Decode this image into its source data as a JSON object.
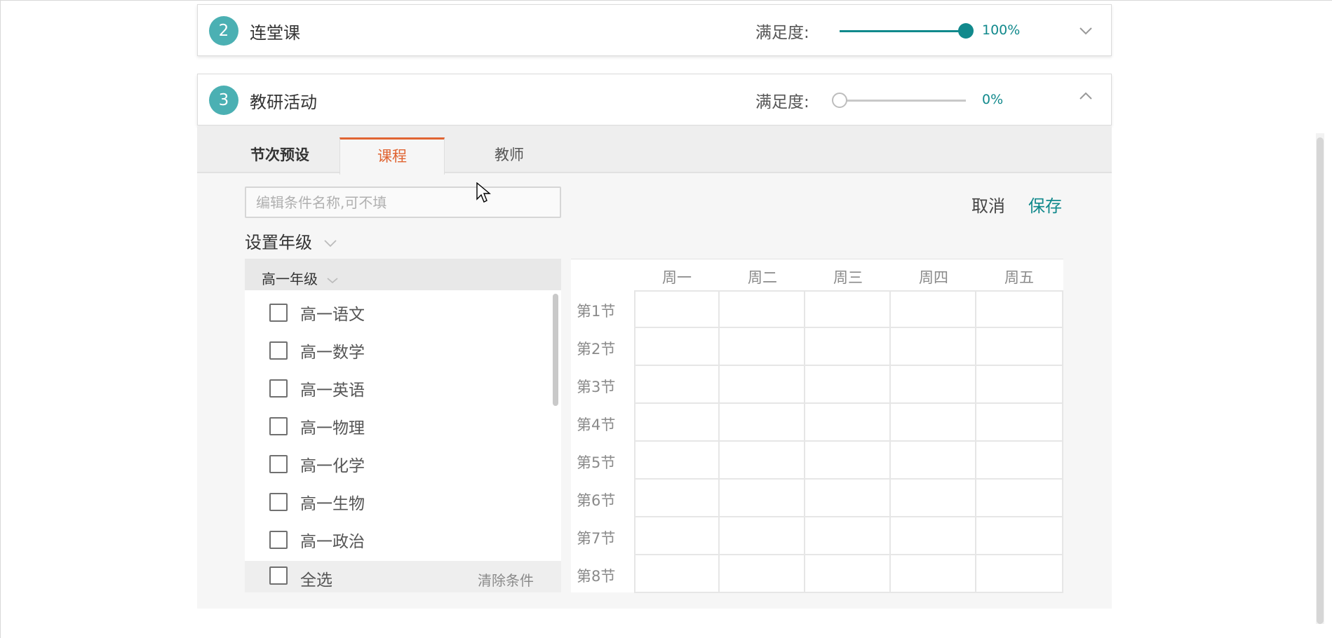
{
  "panels": [
    {
      "number": "2",
      "title": "连堂课",
      "sat_label": "满足度:",
      "sat_value": 100,
      "sat_text": "100%",
      "expanded": false
    },
    {
      "number": "3",
      "title": "教研活动",
      "sat_label": "满足度:",
      "sat_value": 0,
      "sat_text": "0%",
      "expanded": true
    }
  ],
  "tabs": [
    {
      "label": "节次预设",
      "active": false
    },
    {
      "label": "课程",
      "active": true
    },
    {
      "label": "教师",
      "active": false
    }
  ],
  "editor": {
    "name_placeholder": "编辑条件名称,可不填",
    "cancel_label": "取消",
    "save_label": "保存"
  },
  "grade_select": {
    "label": "设置年级"
  },
  "course_panel": {
    "grade": "高一年级",
    "courses": [
      "高一语文",
      "高一数学",
      "高一英语",
      "高一物理",
      "高一化学",
      "高一生物",
      "高一政治"
    ],
    "select_all": "全选",
    "clear": "清除条件"
  },
  "timetable": {
    "days": [
      "周一",
      "周二",
      "周三",
      "周四",
      "周五"
    ],
    "periods": [
      "第1节",
      "第2节",
      "第3节",
      "第4节",
      "第5节",
      "第6节",
      "第7节",
      "第8节"
    ]
  },
  "colors": {
    "accent": "#11898c",
    "tab_active": "#e06432",
    "badge": "#4bb0b3"
  }
}
